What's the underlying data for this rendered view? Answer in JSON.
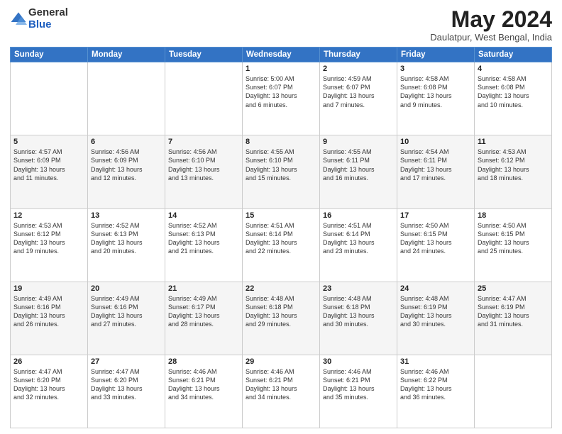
{
  "header": {
    "logo": {
      "general": "General",
      "blue": "Blue"
    },
    "month_title": "May 2024",
    "location": "Daulatpur, West Bengal, India"
  },
  "weekdays": [
    "Sunday",
    "Monday",
    "Tuesday",
    "Wednesday",
    "Thursday",
    "Friday",
    "Saturday"
  ],
  "weeks": [
    [
      {
        "day": "",
        "info": ""
      },
      {
        "day": "",
        "info": ""
      },
      {
        "day": "",
        "info": ""
      },
      {
        "day": "1",
        "info": "Sunrise: 5:00 AM\nSunset: 6:07 PM\nDaylight: 13 hours\nand 6 minutes."
      },
      {
        "day": "2",
        "info": "Sunrise: 4:59 AM\nSunset: 6:07 PM\nDaylight: 13 hours\nand 7 minutes."
      },
      {
        "day": "3",
        "info": "Sunrise: 4:58 AM\nSunset: 6:08 PM\nDaylight: 13 hours\nand 9 minutes."
      },
      {
        "day": "4",
        "info": "Sunrise: 4:58 AM\nSunset: 6:08 PM\nDaylight: 13 hours\nand 10 minutes."
      }
    ],
    [
      {
        "day": "5",
        "info": "Sunrise: 4:57 AM\nSunset: 6:09 PM\nDaylight: 13 hours\nand 11 minutes."
      },
      {
        "day": "6",
        "info": "Sunrise: 4:56 AM\nSunset: 6:09 PM\nDaylight: 13 hours\nand 12 minutes."
      },
      {
        "day": "7",
        "info": "Sunrise: 4:56 AM\nSunset: 6:10 PM\nDaylight: 13 hours\nand 13 minutes."
      },
      {
        "day": "8",
        "info": "Sunrise: 4:55 AM\nSunset: 6:10 PM\nDaylight: 13 hours\nand 15 minutes."
      },
      {
        "day": "9",
        "info": "Sunrise: 4:55 AM\nSunset: 6:11 PM\nDaylight: 13 hours\nand 16 minutes."
      },
      {
        "day": "10",
        "info": "Sunrise: 4:54 AM\nSunset: 6:11 PM\nDaylight: 13 hours\nand 17 minutes."
      },
      {
        "day": "11",
        "info": "Sunrise: 4:53 AM\nSunset: 6:12 PM\nDaylight: 13 hours\nand 18 minutes."
      }
    ],
    [
      {
        "day": "12",
        "info": "Sunrise: 4:53 AM\nSunset: 6:12 PM\nDaylight: 13 hours\nand 19 minutes."
      },
      {
        "day": "13",
        "info": "Sunrise: 4:52 AM\nSunset: 6:13 PM\nDaylight: 13 hours\nand 20 minutes."
      },
      {
        "day": "14",
        "info": "Sunrise: 4:52 AM\nSunset: 6:13 PM\nDaylight: 13 hours\nand 21 minutes."
      },
      {
        "day": "15",
        "info": "Sunrise: 4:51 AM\nSunset: 6:14 PM\nDaylight: 13 hours\nand 22 minutes."
      },
      {
        "day": "16",
        "info": "Sunrise: 4:51 AM\nSunset: 6:14 PM\nDaylight: 13 hours\nand 23 minutes."
      },
      {
        "day": "17",
        "info": "Sunrise: 4:50 AM\nSunset: 6:15 PM\nDaylight: 13 hours\nand 24 minutes."
      },
      {
        "day": "18",
        "info": "Sunrise: 4:50 AM\nSunset: 6:15 PM\nDaylight: 13 hours\nand 25 minutes."
      }
    ],
    [
      {
        "day": "19",
        "info": "Sunrise: 4:49 AM\nSunset: 6:16 PM\nDaylight: 13 hours\nand 26 minutes."
      },
      {
        "day": "20",
        "info": "Sunrise: 4:49 AM\nSunset: 6:16 PM\nDaylight: 13 hours\nand 27 minutes."
      },
      {
        "day": "21",
        "info": "Sunrise: 4:49 AM\nSunset: 6:17 PM\nDaylight: 13 hours\nand 28 minutes."
      },
      {
        "day": "22",
        "info": "Sunrise: 4:48 AM\nSunset: 6:18 PM\nDaylight: 13 hours\nand 29 minutes."
      },
      {
        "day": "23",
        "info": "Sunrise: 4:48 AM\nSunset: 6:18 PM\nDaylight: 13 hours\nand 30 minutes."
      },
      {
        "day": "24",
        "info": "Sunrise: 4:48 AM\nSunset: 6:19 PM\nDaylight: 13 hours\nand 30 minutes."
      },
      {
        "day": "25",
        "info": "Sunrise: 4:47 AM\nSunset: 6:19 PM\nDaylight: 13 hours\nand 31 minutes."
      }
    ],
    [
      {
        "day": "26",
        "info": "Sunrise: 4:47 AM\nSunset: 6:20 PM\nDaylight: 13 hours\nand 32 minutes."
      },
      {
        "day": "27",
        "info": "Sunrise: 4:47 AM\nSunset: 6:20 PM\nDaylight: 13 hours\nand 33 minutes."
      },
      {
        "day": "28",
        "info": "Sunrise: 4:46 AM\nSunset: 6:21 PM\nDaylight: 13 hours\nand 34 minutes."
      },
      {
        "day": "29",
        "info": "Sunrise: 4:46 AM\nSunset: 6:21 PM\nDaylight: 13 hours\nand 34 minutes."
      },
      {
        "day": "30",
        "info": "Sunrise: 4:46 AM\nSunset: 6:21 PM\nDaylight: 13 hours\nand 35 minutes."
      },
      {
        "day": "31",
        "info": "Sunrise: 4:46 AM\nSunset: 6:22 PM\nDaylight: 13 hours\nand 36 minutes."
      },
      {
        "day": "",
        "info": ""
      }
    ]
  ]
}
